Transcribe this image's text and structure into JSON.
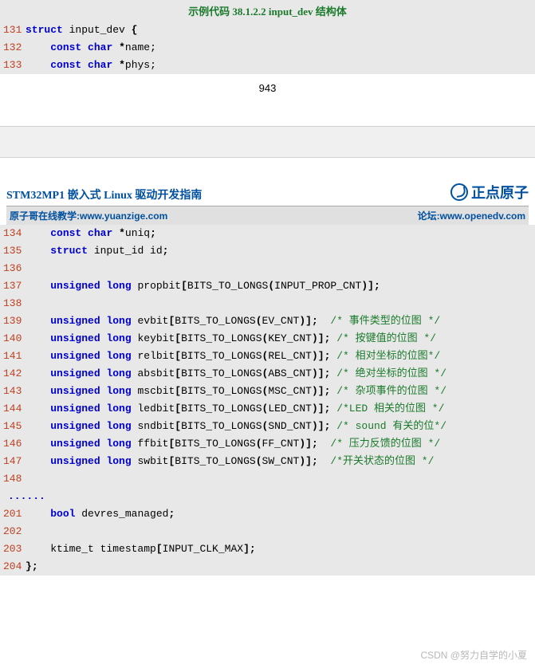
{
  "top_block": {
    "title": "示例代码  38.1.2.2 input_dev  结构体",
    "lines": [
      {
        "n": "131",
        "kw1": "struct",
        "id": "input_dev",
        "pu": "{"
      },
      {
        "n": "132",
        "pad": "    ",
        "kw1": "const",
        "kw2": "char",
        "pu": "*",
        "id": "name;"
      },
      {
        "n": "133",
        "pad": "    ",
        "kw1": "const",
        "kw2": "char",
        "pu": "*",
        "id": "phys;"
      }
    ]
  },
  "page_number": "943",
  "header": {
    "title": "STM32MP1 嵌入式 Linux 驱动开发指南",
    "brand": "正点原子",
    "left_label": "原子哥在线教学:",
    "left_url": "www.yuanzige.com",
    "right_label": "论坛:",
    "right_url": "www.openedv.com"
  },
  "bottom_block": {
    "lines": [
      {
        "n": "134",
        "code": "    const char *uniq;"
      },
      {
        "n": "135",
        "code": "    struct input_id id;"
      },
      {
        "n": "136",
        "code": ""
      },
      {
        "n": "137",
        "code": "    unsigned long propbit[BITS_TO_LONGS(INPUT_PROP_CNT)];"
      },
      {
        "n": "138",
        "code": ""
      },
      {
        "n": "139",
        "code": "    unsigned long evbit[BITS_TO_LONGS(EV_CNT)];",
        "cm": "/* 事件类型的位图 */",
        "col": 49
      },
      {
        "n": "140",
        "code": "    unsigned long keybit[BITS_TO_LONGS(KEY_CNT)];",
        "cm": "/* 按键值的位图 */",
        "col": 49
      },
      {
        "n": "141",
        "code": "    unsigned long relbit[BITS_TO_LONGS(REL_CNT)];",
        "cm": "/* 相对坐标的位图*/",
        "col": 49
      },
      {
        "n": "142",
        "code": "    unsigned long absbit[BITS_TO_LONGS(ABS_CNT)];",
        "cm": "/* 绝对坐标的位图 */",
        "col": 49
      },
      {
        "n": "143",
        "code": "    unsigned long mscbit[BITS_TO_LONGS(MSC_CNT)];",
        "cm": "/* 杂项事件的位图 */",
        "col": 49
      },
      {
        "n": "144",
        "code": "    unsigned long ledbit[BITS_TO_LONGS(LED_CNT)];",
        "cm": "/*LED 相关的位图 */",
        "col": 49
      },
      {
        "n": "145",
        "code": "    unsigned long sndbit[BITS_TO_LONGS(SND_CNT)];",
        "cm": "/* sound 有关的位*/",
        "col": 49
      },
      {
        "n": "146",
        "code": "    unsigned long ffbit[BITS_TO_LONGS(FF_CNT)];",
        "cm": "/* 压力反馈的位图 */",
        "col": 49
      },
      {
        "n": "147",
        "code": "    unsigned long swbit[BITS_TO_LONGS(SW_CNT)];",
        "cm": "/*开关状态的位图 */",
        "col": 49
      },
      {
        "n": "148",
        "code": ""
      }
    ],
    "dots": "......",
    "lines2": [
      {
        "n": "201",
        "code": "    bool devres_managed;"
      },
      {
        "n": "202",
        "code": ""
      },
      {
        "n": "203",
        "code": "    ktime_t timestamp[INPUT_CLK_MAX];"
      },
      {
        "n": "204",
        "code": "};"
      }
    ]
  },
  "watermark": "CSDN @努力自学的小夏"
}
